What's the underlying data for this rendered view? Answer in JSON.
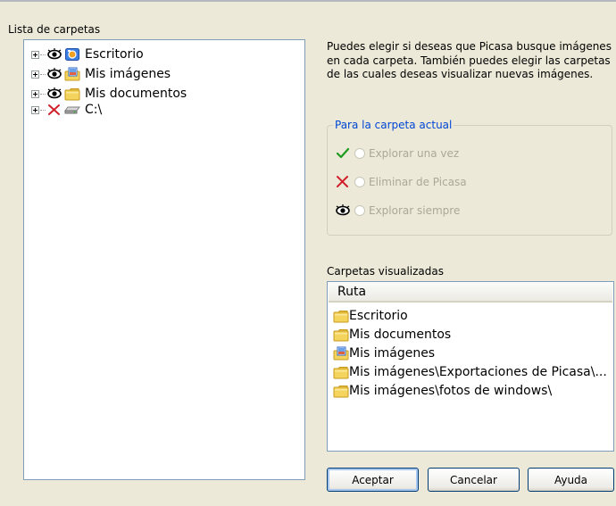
{
  "folder_list": {
    "label": "Lista de carpetas",
    "items": [
      {
        "label": "Escritorio",
        "status_icon": "eye-icon",
        "folder_icon": "desktop-icon"
      },
      {
        "label": "Mis imágenes",
        "status_icon": "eye-icon",
        "folder_icon": "pictures-folder-icon"
      },
      {
        "label": "Mis documentos",
        "status_icon": "eye-icon",
        "folder_icon": "folder-icon"
      },
      {
        "label": "C:\\",
        "status_icon": "red-x-icon",
        "folder_icon": "hard-drive-icon"
      }
    ]
  },
  "description": "Puedes elegir si deseas que Picasa busque imágenes en cada carpeta. También puedes elegir las carpetas de las cuales deseas visualizar nuevas imágenes.",
  "current_folder": {
    "title": "Para la carpeta actual",
    "options": [
      {
        "label": "Explorar una vez",
        "icon": "green-check-icon"
      },
      {
        "label": "Eliminar de Picasa",
        "icon": "red-x-icon"
      },
      {
        "label": "Explorar siempre",
        "icon": "eye-icon"
      }
    ]
  },
  "visualized": {
    "label": "Carpetas visualizadas",
    "column": "Ruta",
    "paths": [
      {
        "label": "Escritorio",
        "icon": "folder-icon"
      },
      {
        "label": "Mis documentos",
        "icon": "folder-icon"
      },
      {
        "label": "Mis imágenes",
        "icon": "pictures-folder-icon"
      },
      {
        "label": "Mis imágenes\\Exportaciones de Picasa\\...",
        "icon": "folder-icon"
      },
      {
        "label": "Mis imágenes\\fotos de windows\\",
        "icon": "folder-icon"
      }
    ]
  },
  "buttons": {
    "accept": "Aceptar",
    "cancel": "Cancelar",
    "help": "Ayuda"
  },
  "colors": {
    "window_bg": "#ece9d8",
    "group_title": "#0046d5",
    "disabled_text": "#aca899",
    "folder_yellow": "#f5d45e"
  }
}
